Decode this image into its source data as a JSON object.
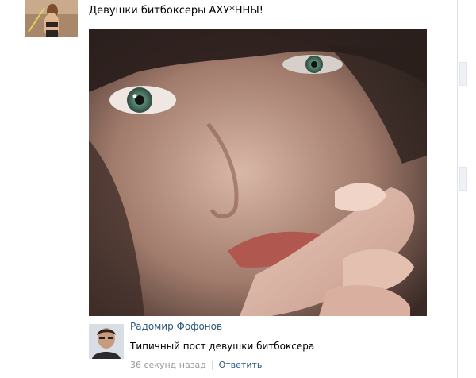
{
  "post": {
    "text": "Девушки битбоксеры АХУ*ННЫ!",
    "author_avatar_icon": "poster-avatar-photo",
    "photo_icon": "post-photo"
  },
  "comment": {
    "author": "Радомир Фофонов",
    "text": "Типичный пост девушки битбоксера",
    "time": "36 секунд назад",
    "separator": "|",
    "reply_label": "Ответить",
    "avatar_icon": "commenter-avatar-photo"
  },
  "colors": {
    "link": "#2b587a",
    "meta": "#999999",
    "text": "#000000"
  }
}
